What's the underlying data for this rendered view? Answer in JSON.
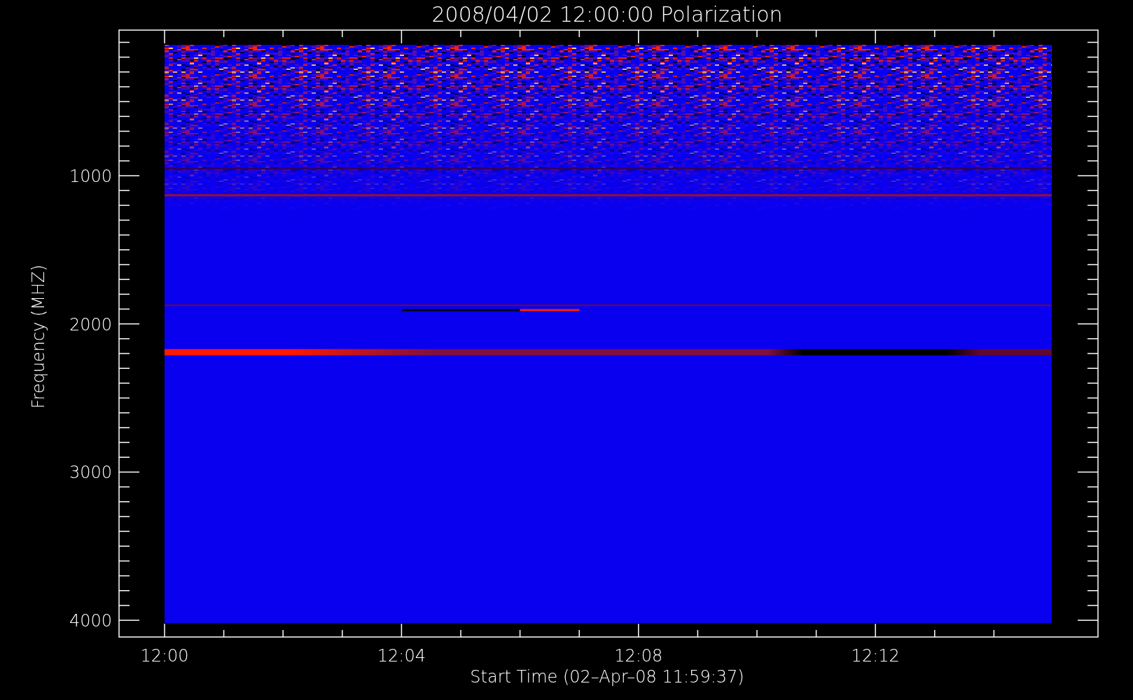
{
  "title": "2008/04/02 12:00:00 Polarization",
  "y_axis": {
    "label": "Frequency (MHZ)",
    "tick_labels": [
      "1000",
      "2000",
      "3000",
      "4000"
    ]
  },
  "x_axis": {
    "label": "Start Time (02–Apr–08 11:59:37)",
    "tick_labels": [
      "12:00",
      "12:04",
      "12:08",
      "12:12"
    ]
  }
}
